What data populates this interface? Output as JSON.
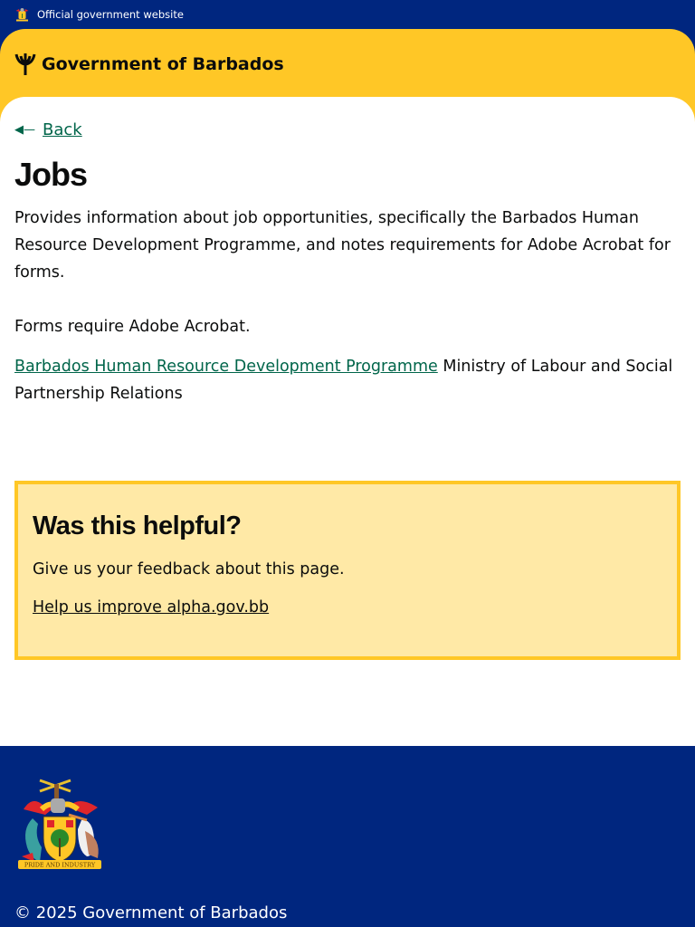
{
  "topbar": {
    "label": "Official government website",
    "icon": "coat-of-arms-icon"
  },
  "header": {
    "brand": "Government of Barbados",
    "icon": "trident-icon"
  },
  "main": {
    "back_label": "Back",
    "title": "Jobs",
    "description": "Provides information about job opportunities, specifically the Barbados Human Resource Development Programme, and notes requirements for Adobe Acrobat for forms.",
    "forms_note": "Forms require Adobe Acrobat.",
    "link_label": "Barbados Human Resource Development Programme",
    "link_suffix": " Ministry of Labour and Social Partnership Relations"
  },
  "feedback": {
    "title": "Was this helpful?",
    "text": "Give us your feedback about this page.",
    "link_label": "Help us improve alpha.gov.bb"
  },
  "footer": {
    "copyright": "© 2025 Government of Barbados",
    "coat_motto": "PRIDE AND INDUSTRY"
  },
  "colors": {
    "blue": "#00267f",
    "yellow": "#ffc726",
    "feedback_bg": "#ffe9a6",
    "link": "#00654a"
  }
}
